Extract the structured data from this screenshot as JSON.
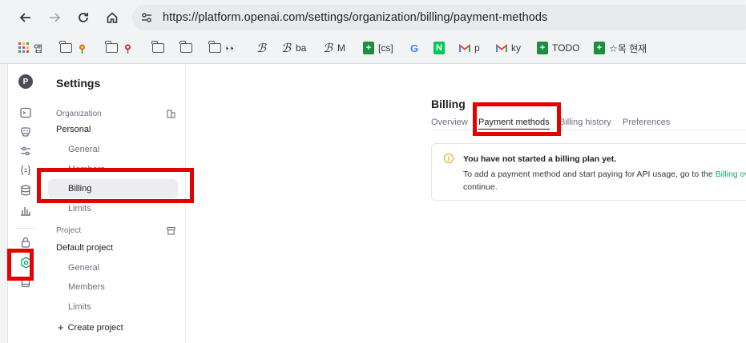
{
  "browser": {
    "url": "https://platform.openai.com/settings/organization/billing/payment-methods",
    "bookmarks": [
      {
        "icon": "apps-grid-icon",
        "label": "앱"
      },
      {
        "icon": "folder-icon",
        "label": ""
      },
      {
        "icon": "folder-icon",
        "label": ""
      },
      {
        "icon": "folder-icon",
        "label": ""
      },
      {
        "icon": "folder-icon",
        "label": ""
      },
      {
        "icon": "folder-icon",
        "label": ""
      },
      {
        "icon": "script-b-icon",
        "label": ""
      },
      {
        "icon": "script-b-icon",
        "label": "ba"
      },
      {
        "icon": "script-b-icon",
        "label": "M"
      },
      {
        "icon": "google-sheets-icon",
        "label": "[cs]"
      },
      {
        "icon": "google-icon",
        "label": ""
      },
      {
        "icon": "naver-icon",
        "label": ""
      },
      {
        "icon": "gmail-icon",
        "label": "p"
      },
      {
        "icon": "gmail-icon",
        "label": "ky"
      },
      {
        "icon": "google-sheets-icon",
        "label": "TODO"
      },
      {
        "icon": "google-sheets-icon",
        "label": "☆목 현재"
      }
    ]
  },
  "rail": {
    "avatar_letter": "P"
  },
  "sidebar": {
    "title": "Settings",
    "organization": {
      "section_label": "Organization",
      "name": "Personal",
      "items": [
        "General",
        "Members",
        "Billing",
        "Limits"
      ],
      "active_item": "Billing"
    },
    "project": {
      "section_label": "Project",
      "name": "Default project",
      "items": [
        "General",
        "Members",
        "Limits"
      ]
    },
    "create_project_label": "Create project"
  },
  "main": {
    "title": "Billing",
    "tabs": [
      "Overview",
      "Payment methods",
      "Billing history",
      "Preferences"
    ],
    "active_tab": "Payment methods",
    "notice": {
      "title": "You have not started a billing plan yet.",
      "body_prefix": "To add a payment method and start paying for API usage, go to the ",
      "link_text": "Billing overview",
      "body_suffix": "continue."
    }
  },
  "colors": {
    "highlight": "#e60000",
    "accent_link": "#10a37f",
    "active_rail_icon": "#10a37f"
  }
}
